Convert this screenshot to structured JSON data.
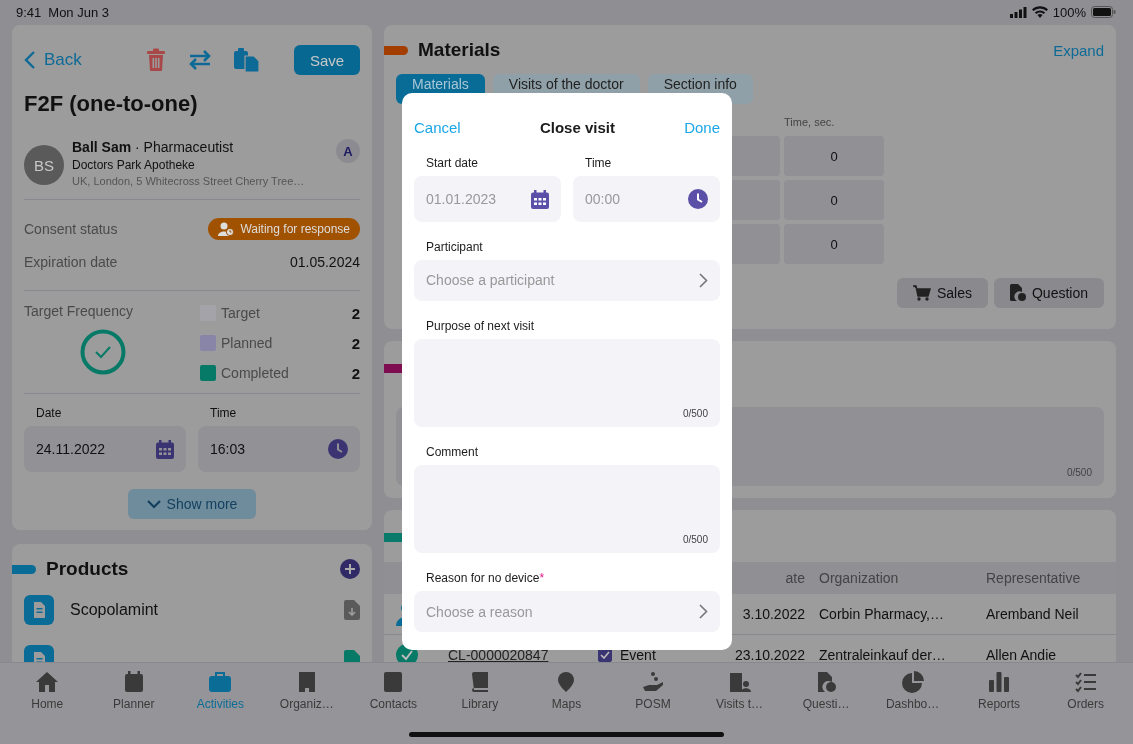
{
  "status_bar": {
    "time": "9:41",
    "date": "Mon Jun 3",
    "battery": "100%"
  },
  "visit": {
    "back": "Back",
    "save": "Save",
    "title": "F2F (one-to-one)",
    "contact": {
      "initials": "BS",
      "heading": "**Ball Sam** · Pharmaceutist",
      "organization": "Doctors Park Apotheke",
      "address": "UK, London, 5 Whitecross Street Cherry Tree…",
      "badge": "A"
    },
    "details": [
      {
        "label": "Consent status",
        "value": "Waiting for response",
        "kind": "badge"
      },
      {
        "label": "Expiration date",
        "value": "01.05.2024",
        "kind": "text"
      }
    ],
    "frequency": {
      "label": "Target Frequency",
      "legend": [
        {
          "label": "Target",
          "value": "2",
          "color": "#a3a3a9"
        },
        {
          "label": "Planned",
          "value": "2",
          "color": "#8985a8"
        },
        {
          "label": "Completed",
          "value": "2",
          "color": "#077a67"
        }
      ]
    },
    "fields": [
      {
        "label": "Date",
        "value": "24.11.2022",
        "kind": "date"
      },
      {
        "label": "Time",
        "value": "16:03",
        "kind": "time"
      }
    ],
    "show_more": "Show more"
  },
  "products": {
    "title": "Products",
    "items": [
      {
        "name": "Scopolamint",
        "kind": "download"
      },
      {
        "kind": "file"
      }
    ]
  },
  "materials": {
    "title": "Materials",
    "expand": "Expand",
    "tabs": [
      {
        "label": "Materials",
        "selected": true
      },
      {
        "label": "Visits of the doctor",
        "selected": false
      },
      {
        "label": "Section info",
        "selected": false
      }
    ],
    "column": "Time, sec.",
    "rows": [
      {
        "value": "0"
      },
      {
        "value": "0"
      },
      {
        "value": "0"
      }
    ],
    "buttons": [
      {
        "label": "Sales",
        "kind": "cart"
      },
      {
        "label": "Question",
        "kind": "question"
      }
    ]
  },
  "notes": {
    "counter": "0/500"
  },
  "records": {
    "columns": [
      "ate",
      "Organization",
      "Representative"
    ],
    "rows": [
      {
        "kind": "person",
        "date": "3.10.2022",
        "organization": "Corbin Pharmacy,…",
        "representative": "Aremband Neil"
      },
      {
        "kind": "done",
        "id": "CL-0000020847",
        "type": "Event",
        "checked": true,
        "date": "23.10.2022",
        "organization": "Zentraleinkauf der…",
        "representative": "Allen Andie"
      }
    ]
  },
  "nav": [
    {
      "label": "Home",
      "kind": "home",
      "selected": false
    },
    {
      "label": "Planner",
      "kind": "calendar",
      "selected": false
    },
    {
      "label": "Activities",
      "kind": "briefcase",
      "selected": true
    },
    {
      "label": "Organiz…",
      "kind": "building",
      "selected": false
    },
    {
      "label": "Contacts",
      "kind": "contacts",
      "selected": false
    },
    {
      "label": "Library",
      "kind": "book",
      "selected": false
    },
    {
      "label": "Maps",
      "kind": "pin",
      "selected": false
    },
    {
      "label": "POSM",
      "kind": "hand",
      "selected": false
    },
    {
      "label": "Visits t…",
      "kind": "visits",
      "selected": false
    },
    {
      "label": "Questi…",
      "kind": "question",
      "selected": false
    },
    {
      "label": "Dashbo…",
      "kind": "pie",
      "selected": false
    },
    {
      "label": "Reports",
      "kind": "bars",
      "selected": false
    },
    {
      "label": "Orders",
      "kind": "list",
      "selected": false
    }
  ],
  "dialog": {
    "title": "Close visit",
    "cancel": "Cancel",
    "done": "Done",
    "start_date": {
      "label": "Start date",
      "placeholder": "01.01.2023"
    },
    "time": {
      "label": "Time",
      "placeholder": "00:00"
    },
    "participant": {
      "label": "Participant",
      "placeholder": "Choose a participant"
    },
    "purpose": {
      "label": "Purpose of next visit",
      "counter": "0/500"
    },
    "comment": {
      "label": "Comment",
      "counter": "0/500"
    },
    "reason": {
      "label": "Reason for no device",
      "required_mark": "*",
      "placeholder": "Choose a reason"
    }
  }
}
